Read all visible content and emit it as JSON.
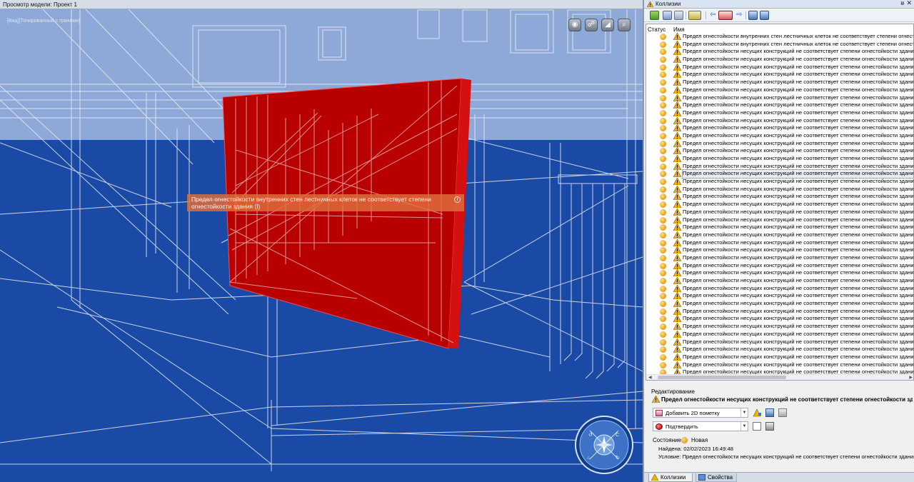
{
  "viewport": {
    "title": "Просмотр модели: Проект 1",
    "view_mode": "[Вид][Тонированный с гранями]",
    "tooltip_text": "Предел огнестойкости внутренних стен лестничных клеток не соответствует степени огнестойкости здания (I)",
    "nav_buttons": [
      "eye-icon",
      "orbit-icon",
      "pan-icon",
      "zoom-icon"
    ],
    "colors": {
      "floor": "#1a4aa6",
      "sky": "#8aa5d6",
      "wall": "#c00000",
      "wire": "#e6e6e6"
    }
  },
  "panel": {
    "title": "Коллизии",
    "pin": "ᵿ",
    "close": "✕",
    "columns": {
      "status": "Статус",
      "name": "Имя"
    },
    "rows": [
      "Предел огнестойкости внутренних стен лестничных клеток не соответствует степени огнестойкости здания (I)",
      "Предел огнестойкости внутренних стен лестничных клеток не соответствует степени огнестойкости здания (I)",
      "Предел огнестойкости несущих конструкций  не соответствует степени огнестойкости здания (I)",
      "Предел огнестойкости несущих конструкций  не соответствует степени огнестойкости здания (I)",
      "Предел огнестойкости несущих конструкций  не соответствует степени огнестойкости здания (I)",
      "Предел огнестойкости несущих конструкций  не соответствует степени огнестойкости здания (I)",
      "Предел огнестойкости несущих конструкций  не соответствует степени огнестойкости здания (I)",
      "Предел огнестойкости несущих конструкций  не соответствует степени огнестойкости здания (I)",
      "Предел огнестойкости несущих конструкций  не соответствует степени огнестойкости здания (I)",
      "Предел огнестойкости несущих конструкций  не соответствует степени огнестойкости здания (I)",
      "Предел огнестойкости несущих конструкций  не соответствует степени огнестойкости здания (I)",
      "Предел огнестойкости несущих конструкций  не соответствует степени огнестойкости здания (I)",
      "Предел огнестойкости несущих конструкций  не соответствует степени огнестойкости здания (I)",
      "Предел огнестойкости несущих конструкций  не соответствует степени огнестойкости здания (I)",
      "Предел огнестойкости несущих конструкций  не соответствует степени огнестойкости здания (I)",
      "Предел огнестойкости несущих конструкций  не соответствует степени огнестойкости здания (I)",
      "Предел огнестойкости несущих конструкций  не соответствует степени огнестойкости здания (I)",
      "Предел огнестойкости несущих конструкций  не соответствует степени огнестойкости здания (I)",
      "Предел огнестойкости несущих конструкций  не соответствует степени огнестойкости здания (I)",
      "Предел огнестойкости несущих конструкций  не соответствует степени огнестойкости здания (I)",
      "Предел огнестойкости несущих конструкций  не соответствует степени огнестойкости здания (I)",
      "Предел огнестойкости несущих конструкций  не соответствует степени огнестойкости здания (I)",
      "Предел огнестойкости несущих конструкций  не соответствует степени огнестойкости здания (I)",
      "Предел огнестойкости несущих конструкций  не соответствует степени огнестойкости здания (I)",
      "Предел огнестойкости несущих конструкций  не соответствует степени огнестойкости здания (I)",
      "Предел огнестойкости несущих конструкций  не соответствует степени огнестойкости здания (I)",
      "Предел огнестойкости несущих конструкций  не соответствует степени огнестойкости здания (I)",
      "Предел огнестойкости несущих конструкций  не соответствует степени огнестойкости здания (I)",
      "Предел огнестойкости несущих конструкций  не соответствует степени огнестойкости здания (I)",
      "Предел огнестойкости несущих конструкций  не соответствует степени огнестойкости здания (I)",
      "Предел огнестойкости несущих конструкций  не соответствует степени огнестойкости здания (I)",
      "Предел огнестойкости несущих конструкций  не соответствует степени огнестойкости здания (I)",
      "Предел огнестойкости несущих конструкций  не соответствует степени огнестойкости здания (I)",
      "Предел огнестойкости несущих конструкций  не соответствует степени огнестойкости здания (I)",
      "Предел огнестойкости несущих конструкций  не соответствует степени огнестойкости здания (I)",
      "Предел огнестойкости несущих конструкций  не соответствует степени огнестойкости здания (I)",
      "Предел огнестойкости несущих конструкций  не соответствует степени огнестойкости здания (I)",
      "Предел огнестойкости несущих конструкций  не соответствует степени огнестойкости здания (I)",
      "Предел огнестойкости несущих конструкций  не соответствует степени огнестойкости здания (I)",
      "Предел огнестойкости несущих конструкций  не соответствует степени огнестойкости здания (I)",
      "Предел огнестойкости несущих конструкций  не соответствует степени огнестойкости здания (I)",
      "Предел огнестойкости несущих конструкций  не соответствует степени огнестойкости здания (I)",
      "Предел огнестойкости несущих конструкций  не соответствует степени огнестойкости здания (I)",
      "Предел огнестойкости несущих конструкций  не соответствует степени огнестойкости здания (I)",
      "Предел огнестойкости несущих конструкций  не соответствует степени огнестойкости здания (I)",
      "Предел огнестойкости несущих конструкций  не соответствует степени огнестойкости здания (I)"
    ],
    "selected_row": 18,
    "status_color": "#e6a21d",
    "edit": {
      "section_label": "Редактирование",
      "title": "Предел огнестойкости несущих конструкций  не соответствует степени огнестойкости здания (I)",
      "markup_combo": "Добавить 2D пометку",
      "action_combo": "Подтвердить",
      "state_label": "Состояние:",
      "state_value": "Новая",
      "found": "Найдена: 02/02/2023 16:49:48",
      "condition": "Условие: Предел огнестойкости несущих конструкций  не соответствует степени огнестойкости здания (I)"
    },
    "tabs": [
      "Коллизии",
      "Свойства"
    ],
    "active_tab": "Коллизии"
  }
}
